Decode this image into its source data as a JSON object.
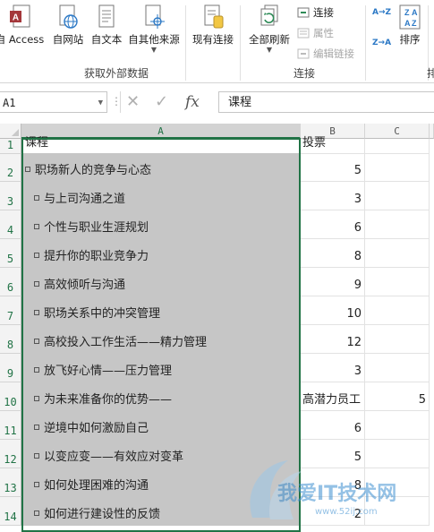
{
  "ribbon": {
    "buttons": [
      {
        "label": "自 Access",
        "icon": "access-icon"
      },
      {
        "label": "自网站",
        "icon": "web-icon"
      },
      {
        "label": "自文本",
        "icon": "text-file-icon"
      },
      {
        "label": "自其他来源",
        "icon": "other-sources-icon"
      },
      {
        "label": "现有连接",
        "icon": "existing-connections-icon"
      },
      {
        "label": "全部刷新",
        "icon": "refresh-all-icon"
      }
    ],
    "small_buttons": {
      "connections": "连接",
      "properties": "属性",
      "edit_links": "编辑链接"
    },
    "sort_label": "排序",
    "sort_icons": [
      "A→Z",
      "Z→A"
    ],
    "group_labels": {
      "get_external": "获取外部数据",
      "connections": "连接"
    },
    "partial_tail": "排"
  },
  "formula_bar": {
    "name_box": "A1",
    "cancel_symbol": "✕",
    "enter_symbol": "✓",
    "fx_label": "fx",
    "content": "课程"
  },
  "grid": {
    "columns": [
      "A",
      "B",
      "C"
    ],
    "rows": [
      {
        "n": "1",
        "a": "课程",
        "b": "投票",
        "c": ""
      },
      {
        "n": "2",
        "a": "职场新人的竞争与心态",
        "b": "5",
        "c": "",
        "indent": 0
      },
      {
        "n": "3",
        "a": "与上司沟通之道",
        "b": "3",
        "c": "",
        "indent": 1
      },
      {
        "n": "4",
        "a": "个性与职业生涯规划",
        "b": "6",
        "c": "",
        "indent": 1
      },
      {
        "n": "5",
        "a": "提升你的职业竞争力",
        "b": "8",
        "c": "",
        "indent": 1
      },
      {
        "n": "6",
        "a": "高效倾听与沟通",
        "b": "9",
        "c": "",
        "indent": 1
      },
      {
        "n": "7",
        "a": "职场关系中的冲突管理",
        "b": "10",
        "c": "",
        "indent": 1
      },
      {
        "n": "8",
        "a": "高校投入工作生活——精力管理",
        "b": "12",
        "c": "",
        "indent": 1
      },
      {
        "n": "9",
        "a": "放飞好心情——压力管理",
        "b": "3",
        "c": "",
        "indent": 1
      },
      {
        "n": "10",
        "a": "为未来准备你的优势——",
        "b": "高潜力员工",
        "c": "5",
        "indent": 1
      },
      {
        "n": "11",
        "a": "逆境中如何激励自己",
        "b": "6",
        "c": "",
        "indent": 1
      },
      {
        "n": "12",
        "a": "以变应变——有效应对变革",
        "b": "5",
        "c": "",
        "indent": 1
      },
      {
        "n": "13",
        "a": "如何处理困难的沟通",
        "b": "8",
        "c": "",
        "indent": 1
      },
      {
        "n": "14",
        "a": "如何进行建设性的反馈",
        "b": "2",
        "c": "",
        "indent": 1
      }
    ]
  },
  "watermark": {
    "text": "我爱IT技术网",
    "url": "www.52ij.com"
  },
  "colors": {
    "accent": "#217346",
    "selection": "#c6c6c6",
    "excel_red": "#c43e1c"
  }
}
